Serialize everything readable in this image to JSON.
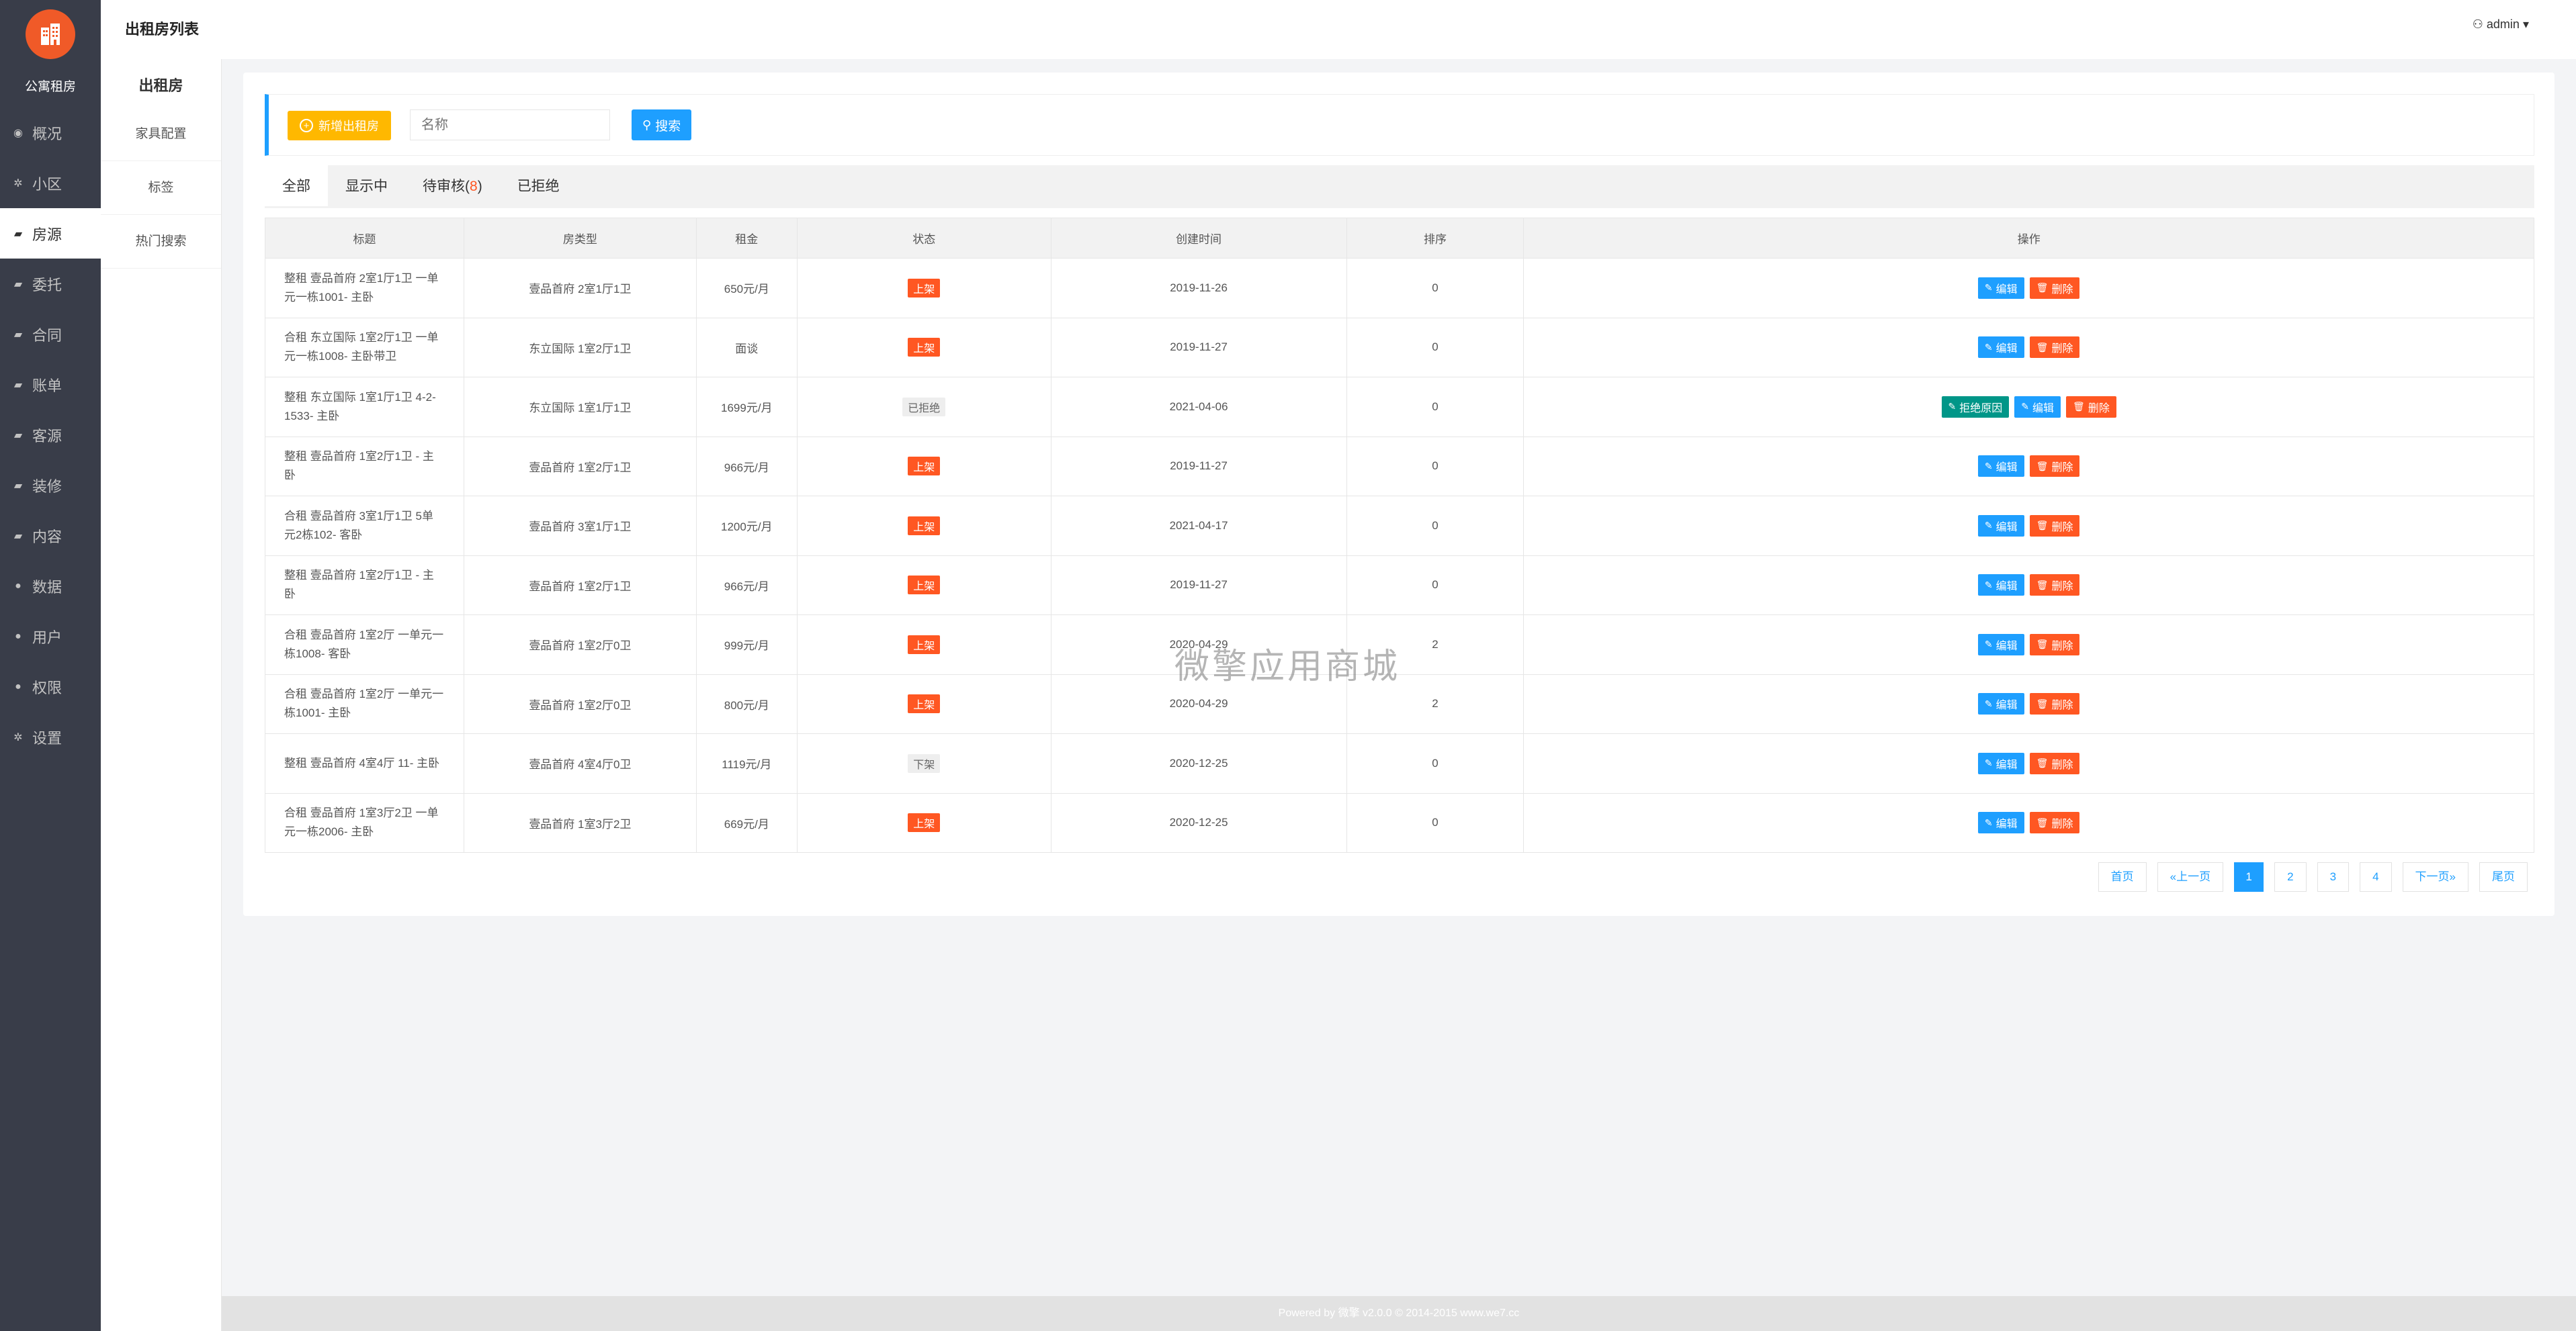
{
  "app": {
    "name": "公寓租房",
    "page_title": "出租房列表",
    "user": "admin"
  },
  "sidebar": {
    "items": [
      {
        "label": "概况",
        "icon": "dashboard-icon"
      },
      {
        "label": "小区",
        "icon": "gear-icon"
      },
      {
        "label": "房源",
        "icon": "book-icon",
        "active": true
      },
      {
        "label": "委托",
        "icon": "book-icon"
      },
      {
        "label": "合同",
        "icon": "book-icon"
      },
      {
        "label": "账单",
        "icon": "book-icon"
      },
      {
        "label": "客源",
        "icon": "book-icon"
      },
      {
        "label": "装修",
        "icon": "book-icon"
      },
      {
        "label": "内容",
        "icon": "book-icon"
      },
      {
        "label": "数据",
        "icon": "user-icon"
      },
      {
        "label": "用户",
        "icon": "user-icon"
      },
      {
        "label": "权限",
        "icon": "user-icon"
      },
      {
        "label": "设置",
        "icon": "gear-icon"
      }
    ]
  },
  "subnav": {
    "title": "出租房",
    "items": [
      "家具配置",
      "标签",
      "热门搜索"
    ]
  },
  "toolbar": {
    "add_label": "新增出租房",
    "search_placeholder": "名称",
    "search_label": "搜索"
  },
  "tabs": [
    {
      "label": "全部",
      "active": true
    },
    {
      "label": "显示中"
    },
    {
      "label": "待审核(",
      "badge": "8",
      "suffix": ")"
    },
    {
      "label": "已拒绝"
    }
  ],
  "table": {
    "columns": [
      "标题",
      "房类型",
      "租金",
      "状态",
      "创建时间",
      "排序",
      "操作"
    ],
    "rows": [
      {
        "title": "整租 壹品首府 2室1厅1卫 一单元一栋1001- 主卧",
        "type": "壹品首府 2室1厅1卫",
        "rent": "650元/月",
        "status": "上架",
        "status_kind": "red",
        "created": "2019-11-26",
        "sort": "0",
        "actions": [
          "编辑",
          "删除"
        ]
      },
      {
        "title": "合租 东立国际 1室2厅1卫 一单元一栋1008- 主卧带卫",
        "type": "东立国际 1室2厅1卫",
        "rent": "面谈",
        "status": "上架",
        "status_kind": "red",
        "created": "2019-11-27",
        "sort": "0",
        "actions": [
          "编辑",
          "删除"
        ]
      },
      {
        "title": "整租 东立国际 1室1厅1卫 4-2-1533- 主卧",
        "type": "东立国际 1室1厅1卫",
        "rent": "1699元/月",
        "status": "已拒绝",
        "status_kind": "gray",
        "created": "2021-04-06",
        "sort": "0",
        "actions": [
          "拒绝原因",
          "编辑",
          "删除"
        ]
      },
      {
        "title": "整租 壹品首府 1室2厅1卫 - 主卧",
        "type": "壹品首府 1室2厅1卫",
        "rent": "966元/月",
        "status": "上架",
        "status_kind": "red",
        "created": "2019-11-27",
        "sort": "0",
        "actions": [
          "编辑",
          "删除"
        ]
      },
      {
        "title": "合租 壹品首府 3室1厅1卫 5单元2栋102- 客卧",
        "type": "壹品首府 3室1厅1卫",
        "rent": "1200元/月",
        "status": "上架",
        "status_kind": "red",
        "created": "2021-04-17",
        "sort": "0",
        "actions": [
          "编辑",
          "删除"
        ]
      },
      {
        "title": "整租 壹品首府 1室2厅1卫 - 主卧",
        "type": "壹品首府 1室2厅1卫",
        "rent": "966元/月",
        "status": "上架",
        "status_kind": "red",
        "created": "2019-11-27",
        "sort": "0",
        "actions": [
          "编辑",
          "删除"
        ]
      },
      {
        "title": "合租 壹品首府 1室2厅 一单元一栋1008- 客卧",
        "type": "壹品首府 1室2厅0卫",
        "rent": "999元/月",
        "status": "上架",
        "status_kind": "red",
        "created": "2020-04-29",
        "sort": "2",
        "actions": [
          "编辑",
          "删除"
        ]
      },
      {
        "title": "合租 壹品首府 1室2厅 一单元一栋1001- 主卧",
        "type": "壹品首府 1室2厅0卫",
        "rent": "800元/月",
        "status": "上架",
        "status_kind": "red",
        "created": "2020-04-29",
        "sort": "2",
        "actions": [
          "编辑",
          "删除"
        ]
      },
      {
        "title": "整租 壹品首府 4室4厅 11- 主卧",
        "type": "壹品首府 4室4厅0卫",
        "rent": "1119元/月",
        "status": "下架",
        "status_kind": "gray",
        "created": "2020-12-25",
        "sort": "0",
        "actions": [
          "编辑",
          "删除"
        ]
      },
      {
        "title": "合租 壹品首府 1室3厅2卫 一单元一栋2006- 主卧",
        "type": "壹品首府 1室3厅2卫",
        "rent": "669元/月",
        "status": "上架",
        "status_kind": "red",
        "created": "2020-12-25",
        "sort": "0",
        "actions": [
          "编辑",
          "删除"
        ]
      }
    ]
  },
  "pagination": {
    "first": "首页",
    "prev": "«上一页",
    "pages": [
      "1",
      "2",
      "3",
      "4"
    ],
    "current": "1",
    "next": "下一页»",
    "last": "尾页"
  },
  "watermark": "微擎应用商城",
  "footer": "Powered by 微擎 v2.0.0 © 2014-2015 www.we7.cc",
  "colors": {
    "sidebar_bg": "#393d49",
    "primary": "#1e9fff",
    "danger": "#ff5722",
    "warning": "#ffb800",
    "success": "#009688",
    "logo": "#f05a28"
  }
}
